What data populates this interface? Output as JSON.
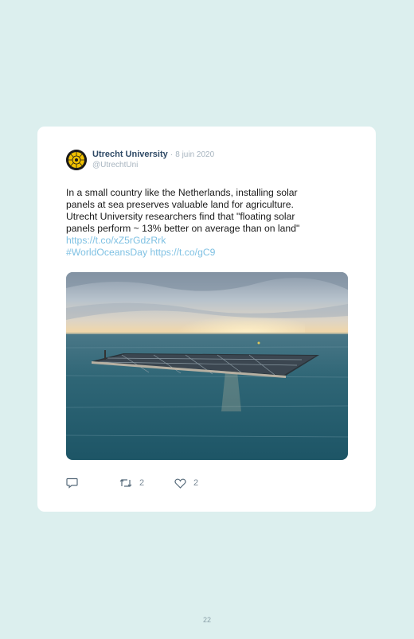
{
  "tweet": {
    "author_name": "Utrecht University",
    "separator": "·",
    "date": "8 juin 2020",
    "handle": "@UtrechtUni",
    "text_lines": [
      "In a small country like the Netherlands, installing solar",
      "panels at sea preserves valuable land for agriculture.",
      "Utrecht University researchers find that \"floating solar",
      "panels perform ~ 13% better on average than on land\""
    ],
    "link_1": "https://t.co/xZ5rGdzRrk",
    "hashtag": "#WorldOceansDay",
    "link_2": "https://t.co/gC9",
    "image_icon": "floating-solar-panels-at-sea-photo"
  },
  "actions": {
    "reply_icon": "reply-icon",
    "retweet_icon": "retweet-icon",
    "retweet_count": "2",
    "like_icon": "heart-icon",
    "like_count": "2"
  },
  "page_number": "22",
  "colors": {
    "background": "#dcefee",
    "card": "#ffffff",
    "author": "#2f4a66",
    "link": "#7fc1e3",
    "muted": "#a7b4bf"
  }
}
